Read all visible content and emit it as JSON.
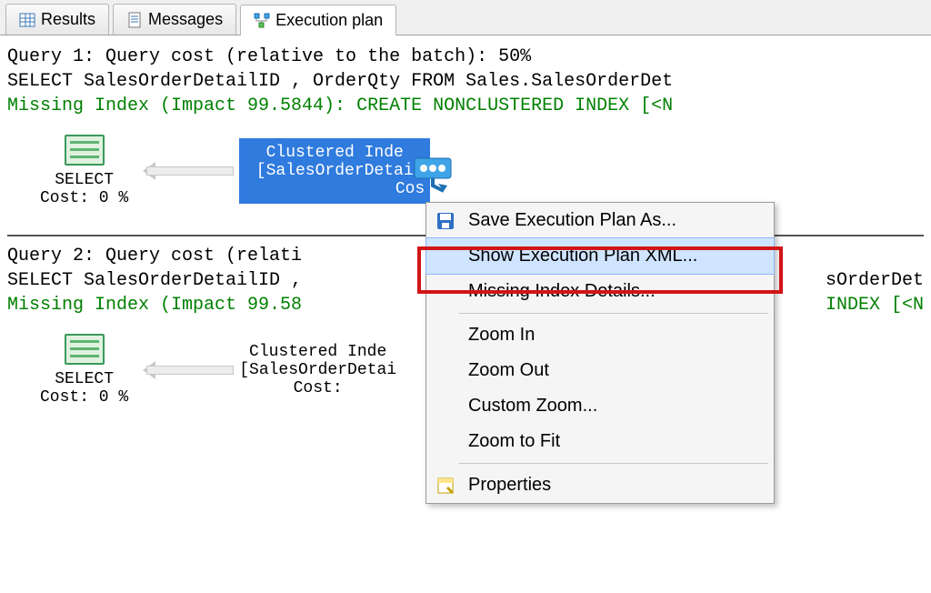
{
  "tabs": {
    "results": "Results",
    "messages": "Messages",
    "execplan": "Execution plan"
  },
  "query1": {
    "header": "Query 1: Query cost (relative to the batch): 50%",
    "sql": "SELECT SalesOrderDetailID , OrderQty FROM Sales.SalesOrderDet",
    "missing": "Missing Index (Impact 99.5844): CREATE NONCLUSTERED INDEX [<N",
    "select_label": "SELECT",
    "select_cost": "Cost: 0 %",
    "scan_line1": "Clustered Inde",
    "scan_line2": "[SalesOrderDetai",
    "scan_line3": "Cos"
  },
  "query2": {
    "header": "Query 2: Query cost (relati",
    "sql": "SELECT SalesOrderDetailID ,",
    "sql_tail": "sOrderDet",
    "missing": "Missing Index (Impact 99.58",
    "missing_tail": "INDEX [<N",
    "select_label": "SELECT",
    "select_cost": "Cost: 0 %",
    "scan_line1": "Clustered Inde",
    "scan_line2": "[SalesOrderDetai",
    "scan_line3": "Cost:"
  },
  "ctx": {
    "save": "Save Execution Plan As...",
    "xml": "Show Execution Plan XML...",
    "miss": "Missing Index Details...",
    "zin": "Zoom In",
    "zout": "Zoom Out",
    "czoom": "Custom Zoom...",
    "zfit": "Zoom to Fit",
    "prop": "Properties"
  }
}
